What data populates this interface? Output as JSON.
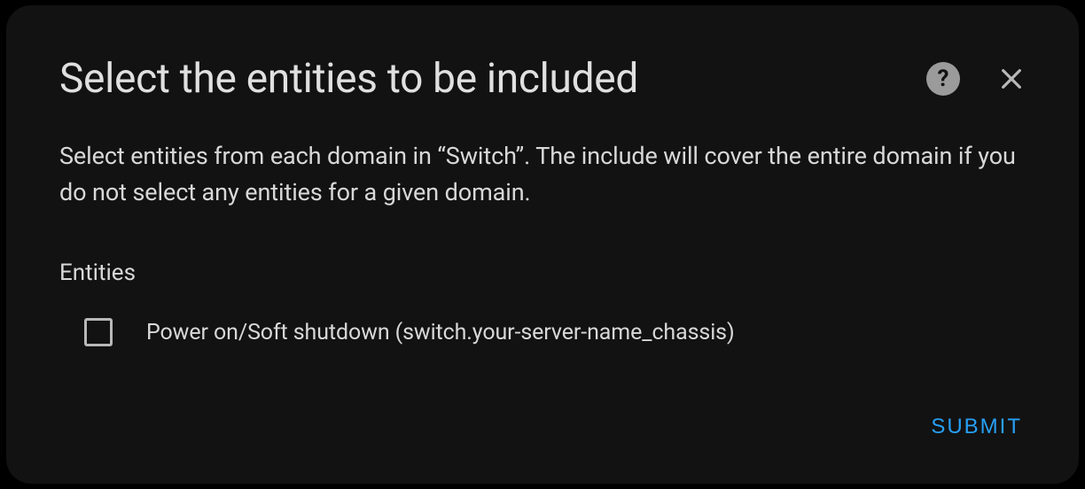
{
  "dialog": {
    "title": "Select the entities to be included",
    "description": "Select entities from each domain in “Switch”. The include will cover the entire domain if you do not select any entities for a given domain.",
    "section_label": "Entities",
    "entities": [
      {
        "label": "Power on/Soft shutdown (switch.your-server-name_chassis)",
        "checked": false
      }
    ],
    "submit_label": "SUBMIT"
  }
}
